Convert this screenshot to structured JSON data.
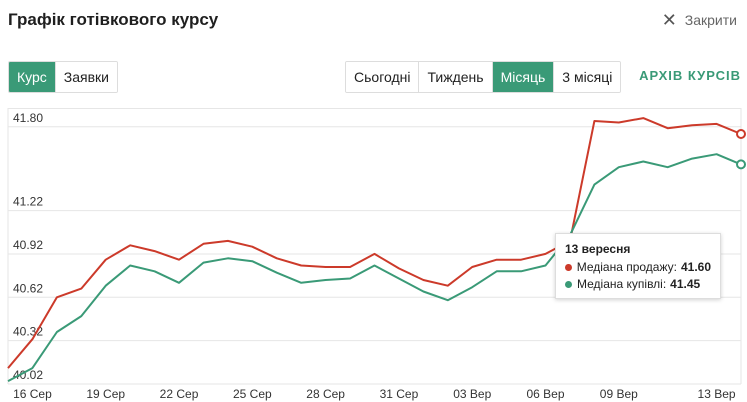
{
  "header": {
    "title": "Графік готівкового курсу",
    "close_label": "Закрити",
    "close_icon": "close-icon"
  },
  "mode_tabs": [
    {
      "label": "Курс",
      "active": true
    },
    {
      "label": "Заявки",
      "active": false
    }
  ],
  "period_tabs": [
    {
      "label": "Сьогодні",
      "active": false
    },
    {
      "label": "Тиждень",
      "active": false
    },
    {
      "label": "Місяць",
      "active": true
    },
    {
      "label": "3 місяці",
      "active": false
    }
  ],
  "archive_label": "АРХІВ КУРСІВ",
  "colors": {
    "accent": "#3a9a77",
    "sell": "#cc3a2a",
    "buy": "#3a9a77"
  },
  "tooltip": {
    "date": "13 вересня",
    "sell_label": "Медіана продажу:",
    "sell_value": "41.60",
    "buy_label": "Медіана купівлі:",
    "buy_value": "41.45"
  },
  "chart_data": {
    "type": "line",
    "x": [
      "15 Сер",
      "16 Сер",
      "17 Сер",
      "18 Сер",
      "19 Сер",
      "20 Сер",
      "21 Сер",
      "22 Сер",
      "23 Сер",
      "24 Сер",
      "25 Сер",
      "26 Сер",
      "27 Сер",
      "28 Сер",
      "29 Сер",
      "30 Сер",
      "31 Сер",
      "01 Вер",
      "02 Вер",
      "03 Вер",
      "04 Вер",
      "05 Вер",
      "06 Вер",
      "07 Вер",
      "08 Вер",
      "09 Вер",
      "10 Вер",
      "11 Вер",
      "12 Вер",
      "13 Вер",
      "14 Вер"
    ],
    "x_tick_labels": [
      "16 Сер",
      "19 Сер",
      "22 Сер",
      "25 Сер",
      "28 Сер",
      "31 Сер",
      "03 Вер",
      "06 Вер",
      "09 Вер",
      "13 Вер"
    ],
    "y_tick_labels": [
      "40.02",
      "40.32",
      "40.62",
      "40.92",
      "41.22",
      "41.80"
    ],
    "ylim": [
      40.02,
      41.93
    ],
    "grid": true,
    "series": [
      {
        "values": [
          40.13,
          40.33,
          40.62,
          40.68,
          40.88,
          40.98,
          40.94,
          40.88,
          40.99,
          41.01,
          40.97,
          40.89,
          40.84,
          40.83,
          40.83,
          40.92,
          40.82,
          40.74,
          40.7,
          40.83,
          40.88,
          40.88,
          40.92,
          41.01,
          41.84,
          41.83,
          41.86,
          41.79,
          41.81,
          41.82,
          41.75
        ]
      },
      {
        "values": [
          40.04,
          40.13,
          40.38,
          40.49,
          40.7,
          40.84,
          40.8,
          40.72,
          40.86,
          40.89,
          40.87,
          40.79,
          40.72,
          40.74,
          40.75,
          40.84,
          40.75,
          40.66,
          40.6,
          40.69,
          40.8,
          40.8,
          40.84,
          41.05,
          41.4,
          41.52,
          41.56,
          41.52,
          41.58,
          41.61,
          41.54
        ]
      }
    ]
  }
}
